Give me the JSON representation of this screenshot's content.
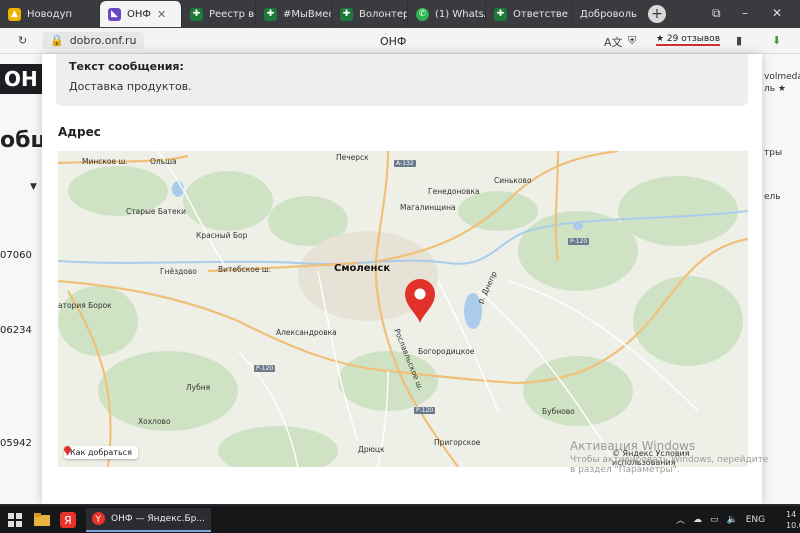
{
  "tabs": [
    {
      "label": "Новодуп",
      "icon": "yandex-direct-icon",
      "active": false
    },
    {
      "label": "ОНФ",
      "icon": "onf-icon",
      "active": true
    },
    {
      "label": "Реестр вол",
      "icon": "sheets-icon",
      "active": false
    },
    {
      "label": "#МыВмест",
      "icon": "sheets-icon",
      "active": false
    },
    {
      "label": "Волонтер",
      "icon": "sheets-icon",
      "active": false
    },
    {
      "label": "(1) WhatsA",
      "icon": "whatsapp-icon",
      "active": false
    },
    {
      "label": "Ответстве",
      "icon": "sheets-icon",
      "active": false
    },
    {
      "label": "Доброволь",
      "icon": "",
      "active": false
    }
  ],
  "address_bar": {
    "url": "dobro.onf.ru",
    "page_title": "ОНФ",
    "reviews": "★ 29 отзывов"
  },
  "background": {
    "logo": "ОН",
    "heading": "обш",
    "numbers": [
      "07060",
      "06234",
      "05942"
    ],
    "right_texts": [
      "volmeda",
      "ль ★",
      "тры",
      "ель"
    ]
  },
  "modal": {
    "message_label": "Текст сообщения:",
    "message_text": "Доставка продуктов.",
    "address_heading": "Адрес"
  },
  "map": {
    "city": "Смоленск",
    "places": [
      "Минское ш.",
      "Ольша",
      "Печерск",
      "Генедоновка",
      "Синьково",
      "Магалинщина",
      "Старые Батеки",
      "Красный Бор",
      "Гнёздово",
      "Витебское ш.",
      "атория Борок",
      "Александровка",
      "Богородицкое",
      "Лубня",
      "Хохлово",
      "Рославльское ш.",
      "Пригорское",
      "Дрюцк",
      "Бубново",
      "р. Днепр"
    ],
    "roads": [
      "А-132",
      "Р-120",
      "Р-120",
      "Р-120"
    ],
    "route_button": "Как добраться",
    "copyright": "© Яндекс Условия использования"
  },
  "watermark": {
    "title": "Активация Windows",
    "text": "Чтобы активировать Windows, перейдите в раздел \"Параметры\"."
  },
  "taskbar": {
    "task_label": "ОНФ — Яндекс.Бр...",
    "lang": "ENG",
    "time": "14",
    "date": "10.0"
  }
}
